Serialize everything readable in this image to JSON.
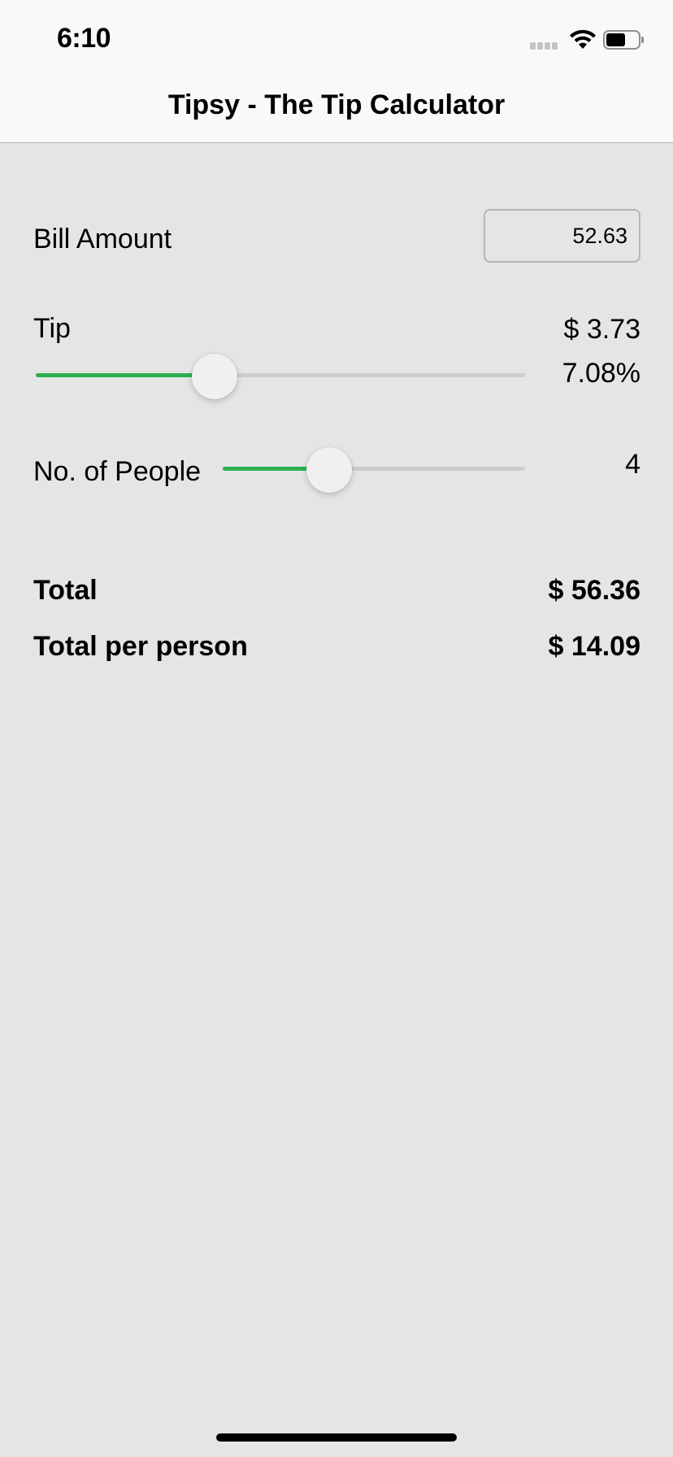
{
  "status_bar": {
    "time": "6:10",
    "signal_icon": "signal-dots-icon",
    "wifi_icon": "wifi-icon",
    "battery_icon": "battery-icon",
    "battery_level": 0.5
  },
  "nav": {
    "title": "Tipsy - The Tip Calculator"
  },
  "bill": {
    "label": "Bill Amount",
    "value": "52.63"
  },
  "tip": {
    "label": "Tip",
    "amount": "$ 3.73",
    "percent": "7.08%",
    "slider_level": 0.365
  },
  "people": {
    "label": "No. of People",
    "count": "4",
    "slider_level": 0.352
  },
  "totals": {
    "total_label": "Total",
    "total_value": "$ 56.36",
    "per_person_label": "Total per person",
    "per_person_value": "$ 14.09"
  },
  "colors": {
    "accent": "#2db052",
    "background": "#e5e5e5",
    "nav_background": "#f9f9f9"
  }
}
